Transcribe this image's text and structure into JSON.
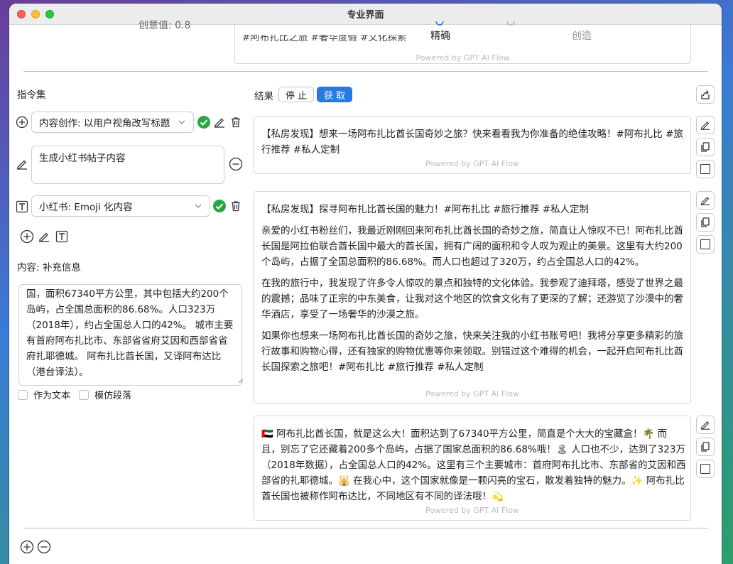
{
  "window": {
    "title": "专业界面"
  },
  "top": {
    "creativity_label": "创意值: 0.8",
    "mode_precise": "精确",
    "mode_creative": "创造",
    "partial_text": "#阿布扎比之旅 #奢华度假 #文化探索",
    "powered": "Powered by GPT AI Flow"
  },
  "left": {
    "section_title": "指令集",
    "instruction1": "内容创作: 以用户视角改写标题",
    "instruction2_text": "生成小红书帖子内容",
    "instruction3": "小红书: Emoji 化内容",
    "content_label": "内容: 补充信息",
    "content_text": "国，面积67340平方公里，其中包括大约200个岛屿，占全国总面积的86.68%。人口323万（2018年），约占全国总人口的42%。 城市主要有首府阿布扎比市、东部省省府艾因和西部省省府扎耶德城。 阿布扎比酋长国，又译阿布达比（港台译法）。",
    "checkbox_as_text": "作为文本",
    "checkbox_imitate": "模仿段落"
  },
  "right": {
    "result_label": "结果",
    "stop_label": "停 止",
    "fetch_label": "获 取",
    "powered": "Powered by GPT AI Flow",
    "card1": "【私房发现】想来一场阿布扎比酋长国奇妙之旅？快来看看我为你准备的绝佳攻略！#阿布扎比 #旅行推荐 #私人定制",
    "card2_p1": "【私房发现】探寻阿布扎比酋长国的魅力！#阿布扎比 #旅行推荐 #私人定制",
    "card2_p2": "亲爱的小红书粉丝们，我最近刚刚回来阿布扎比酋长国的奇妙之旅，简直让人惊叹不已！阿布扎比酋长国是阿拉伯联合酋长国中最大的酋长国，拥有广阔的面积和令人叹为观止的美景。这里有大约200个岛屿，占据了全国总面积的86.68%。而人口也超过了320万，约占全国总人口的42%。",
    "card2_p3": "在我的旅行中，我发现了许多令人惊叹的景点和独特的文化体验。我参观了迪拜塔，感受了世界之最的震撼；品味了正宗的中东美食，让我对这个地区的饮食文化有了更深的了解；还游览了沙漠中的奢华酒店，享受了一场奢华的沙漠之旅。",
    "card2_p4": "如果你也想来一场阿布扎比酋长国的奇妙之旅，快来关注我的小红书账号吧！我将分享更多精彩的旅行故事和购物心得，还有独家的购物优惠等你来领取。别错过这个难得的机会，一起开启阿布扎比酋长国探索之旅吧！#阿布扎比 #旅行推荐 #私人定制",
    "card3": "🇦🇪 阿布扎比酋长国，就是这么大！面积达到了67340平方公里，简直是个大大的宝藏盒！🌴 而且，别忘了它还藏着200多个岛屿，占据了国家总面积的86.68%哦！🏝 人口也不少，达到了323万（2018年数据），占全国总人口的42%。这里有三个主要城市：首府阿布扎比市、东部省的艾因和西部省的扎耶德城。🕌 在我心中，这个国家就像是一颗闪亮的宝石，散发着独特的魅力。✨ 阿布扎比酋长国也被称作阿布达比，不同地区有不同的译法哦！💫"
  },
  "colors": {
    "accent": "#2a7ae2",
    "check_green": "#27a745"
  }
}
